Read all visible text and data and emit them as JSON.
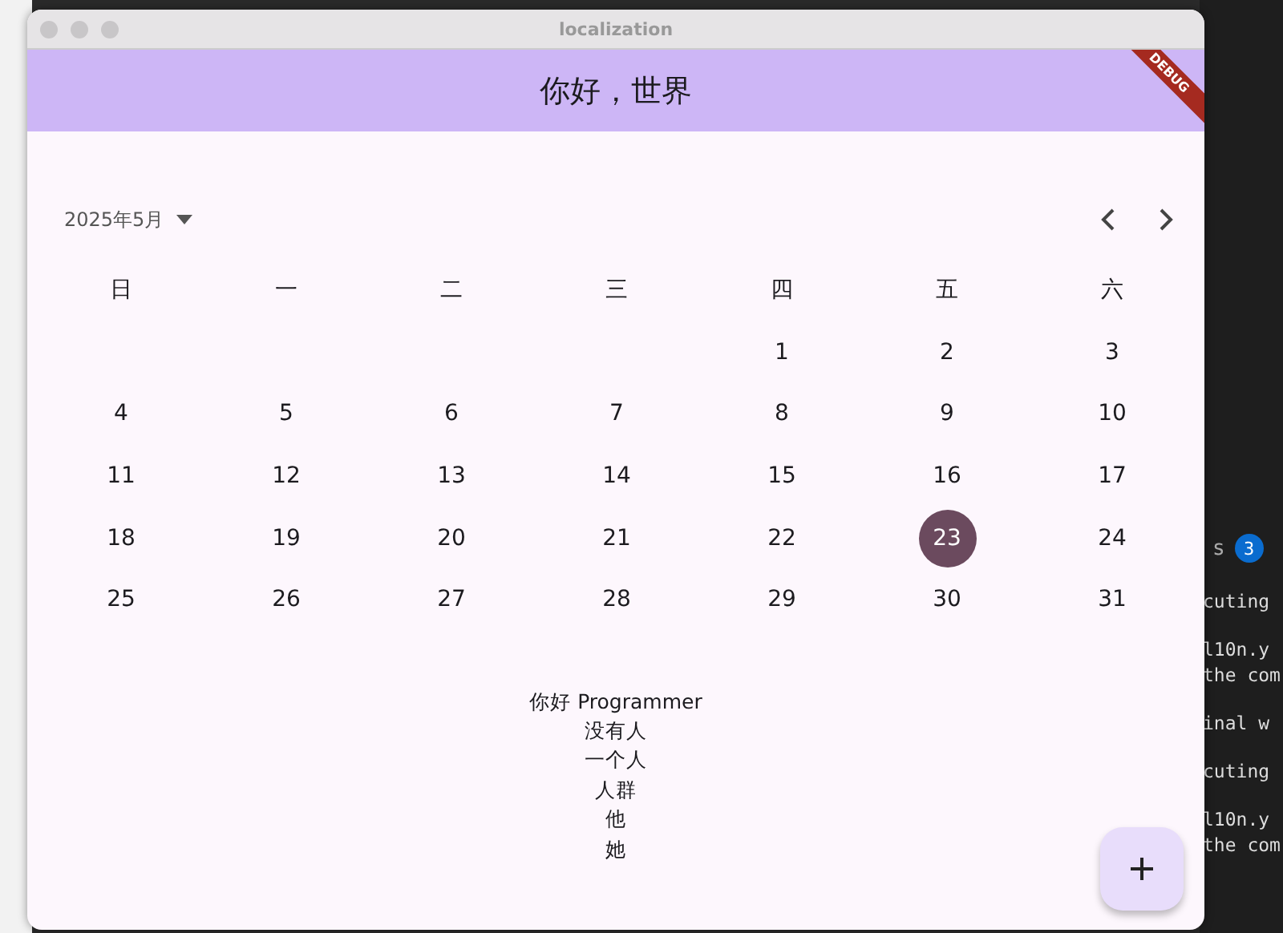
{
  "window": {
    "title": "localization"
  },
  "app_bar": {
    "title": "你好，世界",
    "debug_banner": "DEBUG"
  },
  "calendar": {
    "month_label": "2025年5月",
    "weekdays": [
      "日",
      "一",
      "二",
      "三",
      "四",
      "五",
      "六"
    ],
    "weeks": [
      [
        {
          "label": "1",
          "selected": false
        },
        {
          "label": "2",
          "selected": false
        },
        {
          "label": "3",
          "selected": false
        }
      ],
      [
        {
          "label": "4",
          "selected": false
        },
        {
          "label": "5",
          "selected": false
        },
        {
          "label": "6",
          "selected": false
        },
        {
          "label": "7",
          "selected": false
        },
        {
          "label": "8",
          "selected": false
        },
        {
          "label": "9",
          "selected": false
        },
        {
          "label": "10",
          "selected": false
        }
      ],
      [
        {
          "label": "11",
          "selected": false
        },
        {
          "label": "12",
          "selected": false
        },
        {
          "label": "13",
          "selected": false
        },
        {
          "label": "14",
          "selected": false
        },
        {
          "label": "15",
          "selected": false
        },
        {
          "label": "16",
          "selected": false
        },
        {
          "label": "17",
          "selected": false
        }
      ],
      [
        {
          "label": "18",
          "selected": false
        },
        {
          "label": "19",
          "selected": false
        },
        {
          "label": "20",
          "selected": false
        },
        {
          "label": "21",
          "selected": false
        },
        {
          "label": "22",
          "selected": false
        },
        {
          "label": "23",
          "selected": true
        },
        {
          "label": "24",
          "selected": false
        }
      ],
      [
        {
          "label": "25",
          "selected": false
        },
        {
          "label": "26",
          "selected": false
        },
        {
          "label": "27",
          "selected": false
        },
        {
          "label": "28",
          "selected": false
        },
        {
          "label": "29",
          "selected": false
        },
        {
          "label": "30",
          "selected": false
        },
        {
          "label": "31",
          "selected": false
        }
      ]
    ]
  },
  "messages": [
    "你好 Programmer",
    "没有人",
    "一个人",
    "人群",
    "他",
    "她"
  ],
  "background_terminal": {
    "tab_label": "s",
    "tab_badge": "3",
    "blocks": [
      [
        "cuting"
      ],
      [
        "l10n.y",
        "the com"
      ],
      [
        "inal w"
      ],
      [
        "cuting"
      ],
      [
        "l10n.y",
        "the com"
      ]
    ]
  }
}
